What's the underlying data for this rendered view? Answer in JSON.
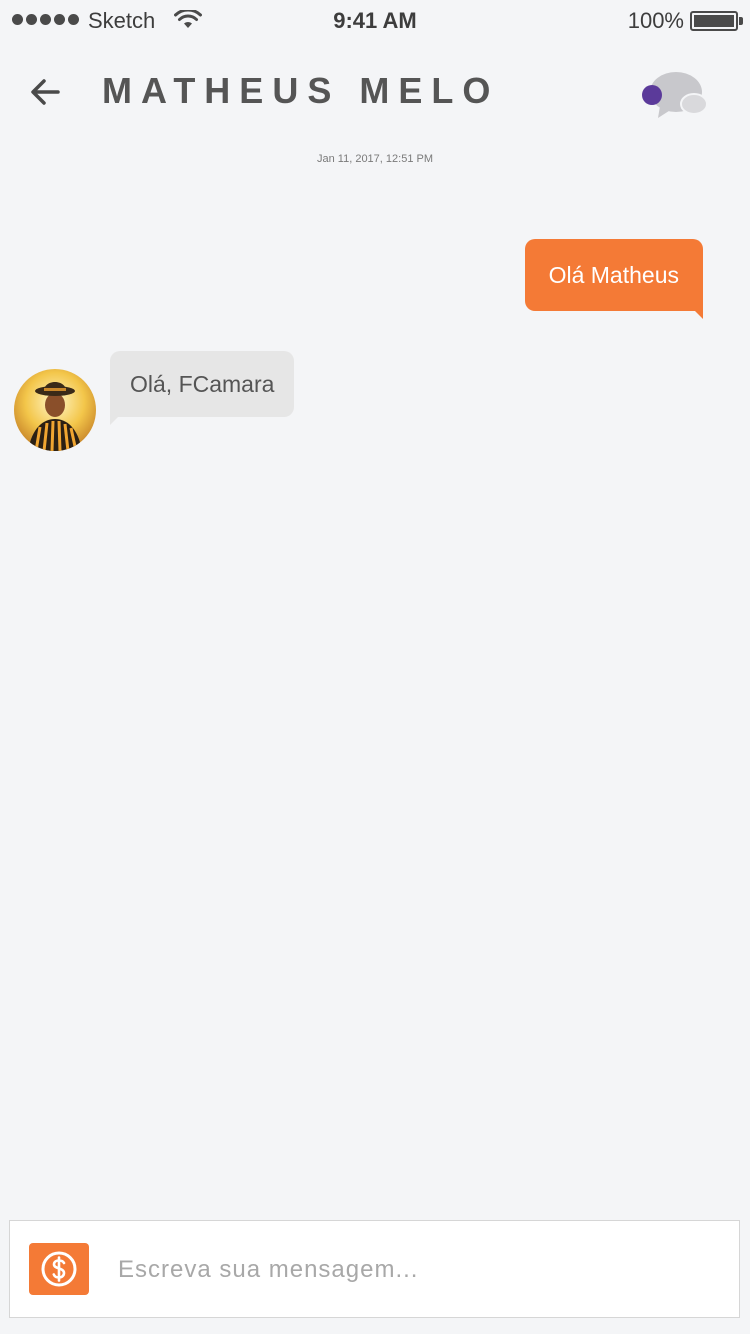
{
  "status_bar": {
    "carrier": "Sketch",
    "time": "9:41 AM",
    "battery_percent": "100%"
  },
  "header": {
    "title": "MATHEUS MELO",
    "back_icon": "arrow-left-icon",
    "chat_icon": "chat-bubbles-icon",
    "online_dot_color": "#5b3a9a"
  },
  "conversation": {
    "timestamp": "Jan 11, 2017, 12:51 PM",
    "messages": [
      {
        "direction": "sent",
        "text": "Olá Matheus"
      },
      {
        "direction": "received",
        "text": "Olá, FCamara"
      }
    ]
  },
  "composer": {
    "placeholder": "Escreva sua mensagem...",
    "value": "",
    "money_icon": "dollar-circle-icon"
  },
  "colors": {
    "accent": "#f47a36",
    "received_bubble": "#e6e6e6",
    "background": "#f4f5f7"
  }
}
